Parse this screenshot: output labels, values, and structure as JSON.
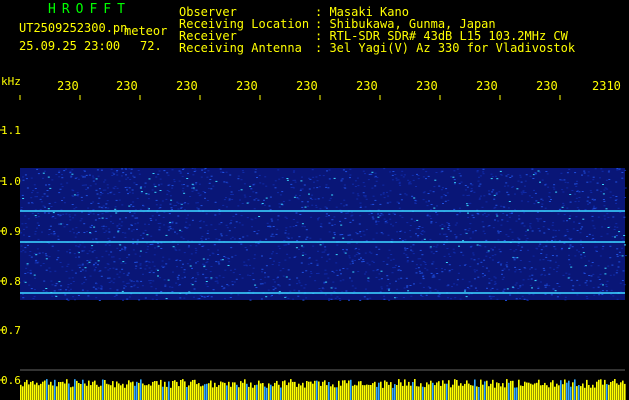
{
  "header": {
    "app_title": "HROFFT",
    "file_name": "UT2509252300.pn",
    "mode": "meteor",
    "date_time": "25.09.25 23:00",
    "count": "72."
  },
  "info": [
    {
      "key": "Observer",
      "value": ": Masaki Kano"
    },
    {
      "key": "Receiving Location",
      "value": ": Shibukawa, Gunma, Japan"
    },
    {
      "key": "Receiver",
      "value": ": RTL-SDR SDR# 43dB L15 103.2MHz CW"
    },
    {
      "key": "Receiving Antenna",
      "value": ": 3el Yagi(V) Az 330 for Vladivostok"
    }
  ],
  "axis": {
    "unit": "kHz",
    "y_ticks": [
      "1.1",
      "1.0",
      "0.9",
      "0.8",
      "0.7",
      "0.6"
    ],
    "time_ticks": [
      "230",
      "230",
      "230",
      "230",
      "230",
      "230",
      "230",
      "230",
      "230",
      "2310"
    ]
  },
  "colors": {
    "text": "#ffff00",
    "title": "#00ff00",
    "background": "#000000",
    "band": "#0a1a8c",
    "signal": "#3ad0ff"
  }
}
